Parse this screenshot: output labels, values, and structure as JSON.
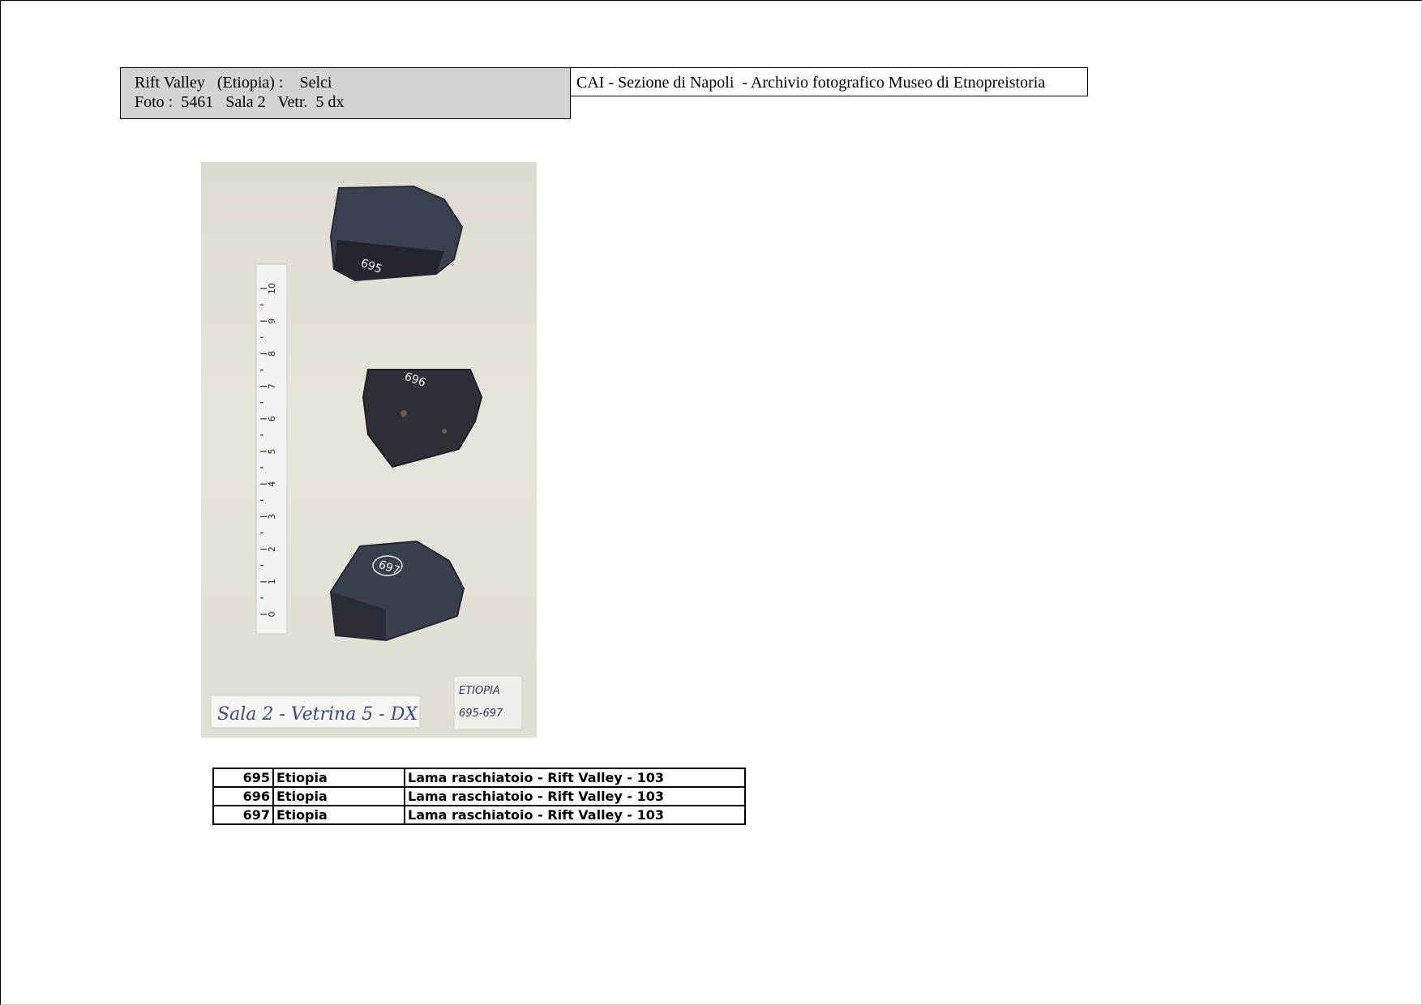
{
  "header": {
    "line1": "Rift Valley   (Etiopia) :    Selci",
    "line2": "Foto :  5461   Sala 2   Vetr.  5 dx",
    "archive": "CAI - Sezione di Napoli  - Archivio fotografico Museo di Etnopreistoria"
  },
  "photo": {
    "ruler_marks": [
      "0",
      "1",
      "2",
      "3",
      "4",
      "5",
      "6",
      "7",
      "8",
      "9",
      "10"
    ],
    "stone_labels": [
      "695",
      "696",
      "697"
    ],
    "label_card": "Sala 2 - Vetrina 5 - DX",
    "tag_line1": "ETIOPIA",
    "tag_line2": "695-697"
  },
  "items": [
    {
      "num": "695",
      "place": "Etiopia",
      "desc": "Lama raschiatoio - Rift Valley - 103"
    },
    {
      "num": "696",
      "place": "Etiopia",
      "desc": "Lama raschiatoio - Rift Valley - 103"
    },
    {
      "num": "697",
      "place": "Etiopia",
      "desc": "Lama raschiatoio - Rift Valley - 103"
    }
  ]
}
